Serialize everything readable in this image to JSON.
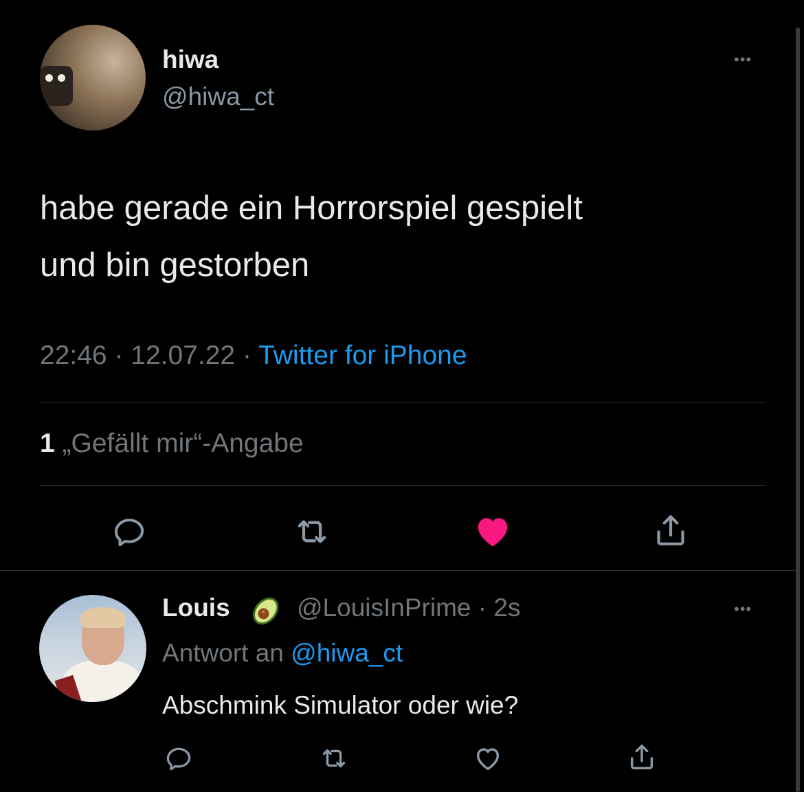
{
  "tweet": {
    "author_name": "hiwa",
    "author_handle": "@hiwa_ct",
    "more_label": "•••",
    "text_line1": "habe gerade ein Horrorspiel gespielt",
    "text_line2": "und bin gestorben",
    "time": "22:46",
    "date": "12.07.22",
    "separator": "·",
    "source": "Twitter for iPhone",
    "likes_count": "1",
    "likes_label": "„Gefällt mir“-Angabe",
    "liked": true
  },
  "reply": {
    "author_name": "Louis",
    "badge_icon": "avocado-emoji",
    "author_handle": "@LouisInPrime",
    "separator": "·",
    "age": "2s",
    "more_label": "•••",
    "reply_to_prefix": "Antwort an",
    "reply_to_handle": "@hiwa_ct",
    "text": "Abschmink Simulator oder wie?",
    "liked": false
  },
  "colors": {
    "background": "#000000",
    "text": "#e7e9ea",
    "muted": "#71767b",
    "link": "#1d9bf0",
    "like": "#f91880",
    "divider": "#2f3336"
  }
}
